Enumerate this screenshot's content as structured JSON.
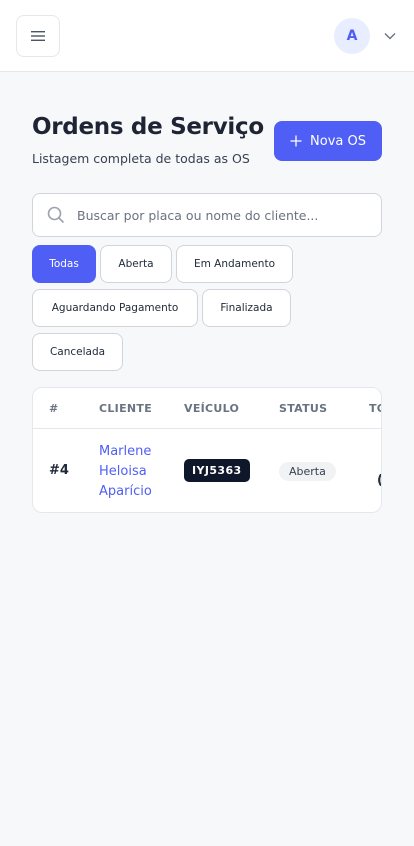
{
  "header": {
    "menu_icon": "menu-icon",
    "user_initial": "A",
    "dropdown_icon": "chevron-down-icon"
  },
  "page": {
    "title": "Ordens de Serviço",
    "subtitle": "Listagem completa de todas as OS",
    "new_button_label": "Nova OS"
  },
  "search": {
    "placeholder": "Buscar por placa ou nome do cliente...",
    "value": ""
  },
  "filters": [
    {
      "label": "Todas",
      "active": true
    },
    {
      "label": "Aberta",
      "active": false
    },
    {
      "label": "Em Andamento",
      "active": false
    },
    {
      "label": "Aguardando Pagamento",
      "active": false
    },
    {
      "label": "Finalizada",
      "active": false
    },
    {
      "label": "Cancelada",
      "active": false
    }
  ],
  "table": {
    "columns": [
      "#",
      "CLIENTE",
      "VEÍCULO",
      "STATUS",
      "TO"
    ],
    "rows": [
      {
        "id": "#4",
        "client": "Marlene Heloisa Aparício",
        "plate": "IYJ5363",
        "status": "Aberta",
        "total_partial": "("
      }
    ]
  },
  "colors": {
    "accent": "#4f5ef5",
    "plate_bg": "#0f172a",
    "page_bg": "#f7f8fa"
  }
}
